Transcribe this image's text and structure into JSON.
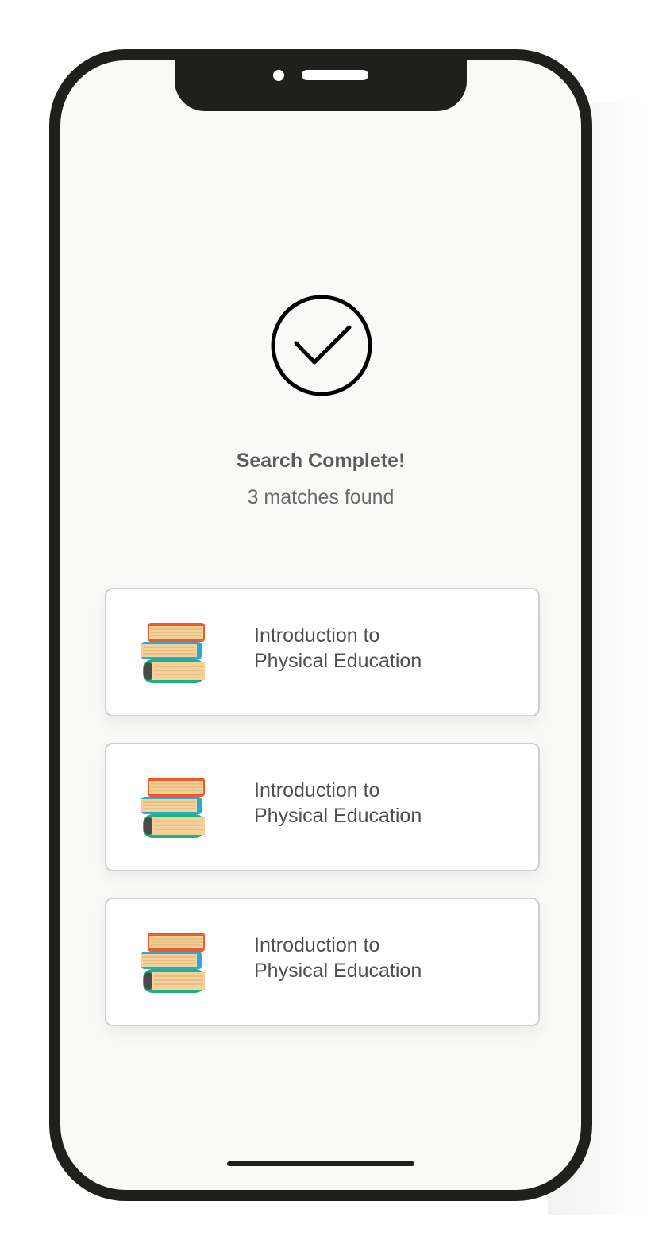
{
  "status": {
    "icon": "checkmark-circle-icon",
    "title": "Search Complete!",
    "subtitle": "3 matches found"
  },
  "results": [
    {
      "icon": "books-stack-icon",
      "line1": "Introduction to",
      "line2": "Physical Education"
    },
    {
      "icon": "books-stack-icon",
      "line1": "Introduction to",
      "line2": "Physical Education"
    },
    {
      "icon": "books-stack-icon",
      "line1": "Introduction to",
      "line2": "Physical Education"
    }
  ],
  "colors": {
    "frame": "#1f1f1b",
    "screen": "#f9faf8",
    "book_top": "#f05a28",
    "book_middle": "#29a8dc",
    "book_bottom": "#1fb27c",
    "pages": "#f2d19a"
  }
}
